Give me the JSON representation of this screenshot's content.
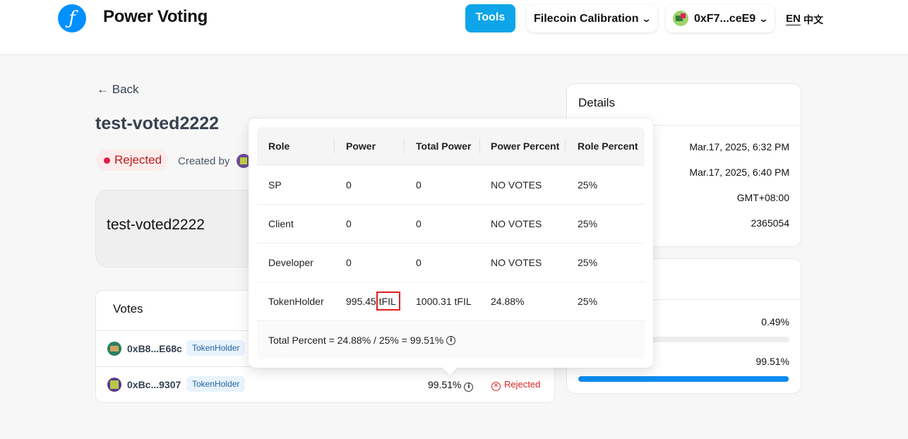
{
  "header": {
    "logo_glyph": "ƒ",
    "app_title": "Power Voting",
    "tools_label": "Tools",
    "network_label": "Filecoin Calibration",
    "wallet_label": "0xF7...ceE9",
    "lang_en": "EN",
    "lang_zh": "中文"
  },
  "proposal": {
    "back_label": "Back",
    "title": "test-voted2222",
    "status": "Rejected",
    "created_by_label": "Created by",
    "description": "test-voted2222"
  },
  "votes": {
    "title": "Votes",
    "rows": [
      {
        "address": "0xB8...E68c",
        "tag": "TokenHolder",
        "percent": "",
        "status": ""
      },
      {
        "address": "0xBc...9307",
        "tag": "TokenHolder",
        "percent": "99.51%",
        "status": "Rejected"
      }
    ]
  },
  "details": {
    "title": "Details",
    "values": [
      "Mar.17, 2025, 6:32 PM",
      "Mar.17, 2025, 6:40 PM",
      "GMT+08:00",
      "2365054"
    ]
  },
  "results": {
    "items": [
      {
        "percent": "0.49%",
        "fraction": 0.0049
      },
      {
        "percent": "99.51%",
        "fraction": 0.9951
      }
    ]
  },
  "popover": {
    "headers": [
      "Role",
      "Power",
      "Total Power",
      "Power Percent",
      "Role Percent"
    ],
    "rows": [
      [
        "SP",
        "0",
        "0",
        "NO VOTES",
        "25%"
      ],
      [
        "Client",
        "0",
        "0",
        "NO VOTES",
        "25%"
      ],
      [
        "Developer",
        "0",
        "0",
        "NO VOTES",
        "25%"
      ],
      [
        "TokenHolder",
        "995.45 tFIL",
        "1000.31 tFIL",
        "24.88%",
        "25%"
      ]
    ],
    "total_text": "Total Percent =  24.88% / 25% = 99.51%"
  },
  "colors": {
    "accent": "#0ea5e9",
    "logo": "#0090ff",
    "rejected": "#dc2626",
    "bar": "#0b8cf0"
  },
  "icons": [
    "filecoin-logo-icon",
    "chevron-down-icon",
    "arrow-left-icon",
    "info-icon",
    "x-circle-icon"
  ]
}
